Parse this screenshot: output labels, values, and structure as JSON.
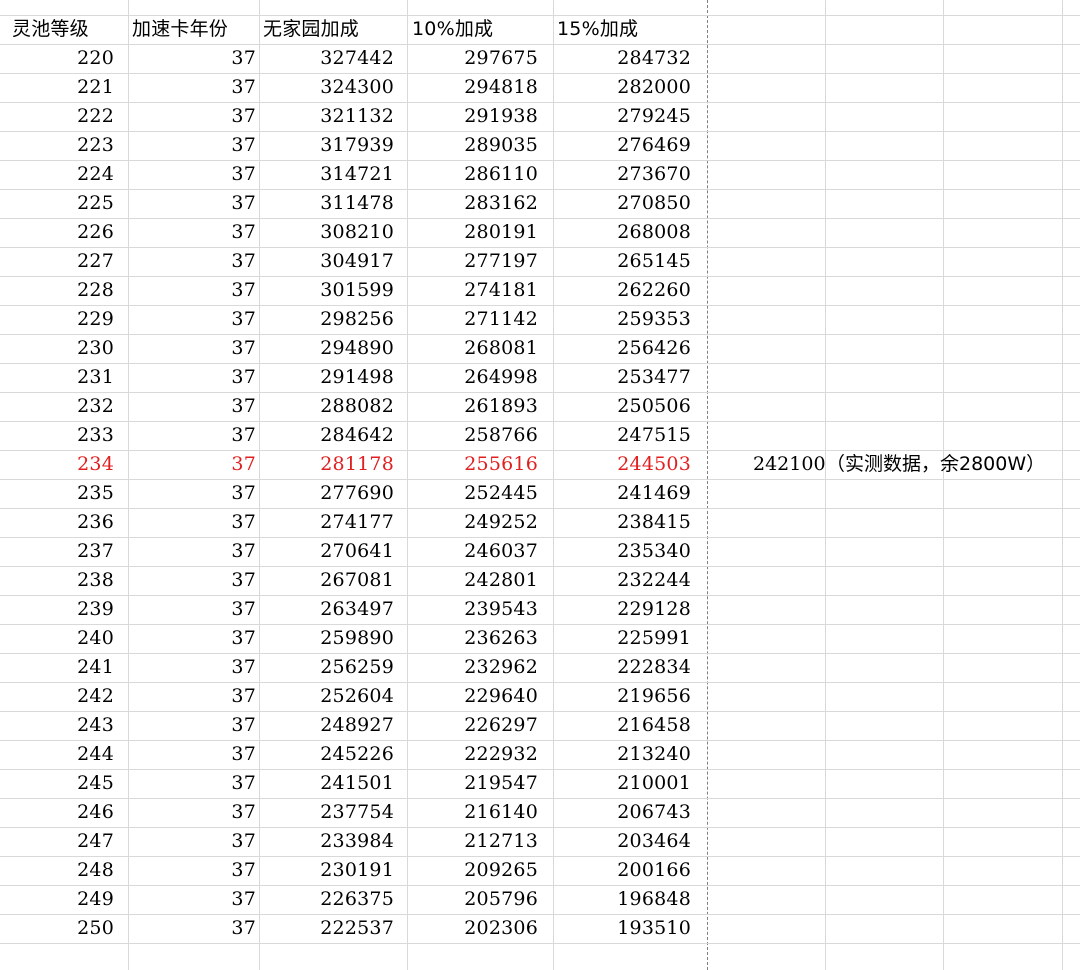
{
  "sheet": {
    "headers": [
      "灵池等级",
      "加速卡年份",
      "无家园加成",
      "10%加成",
      "15%加成"
    ],
    "highlight_color": "#e02020",
    "highlight_level": "234",
    "rows": [
      [
        "220",
        "37",
        "327442",
        "297675",
        "284732"
      ],
      [
        "221",
        "37",
        "324300",
        "294818",
        "282000"
      ],
      [
        "222",
        "37",
        "321132",
        "291938",
        "279245"
      ],
      [
        "223",
        "37",
        "317939",
        "289035",
        "276469"
      ],
      [
        "224",
        "37",
        "314721",
        "286110",
        "273670"
      ],
      [
        "225",
        "37",
        "311478",
        "283162",
        "270850"
      ],
      [
        "226",
        "37",
        "308210",
        "280191",
        "268008"
      ],
      [
        "227",
        "37",
        "304917",
        "277197",
        "265145"
      ],
      [
        "228",
        "37",
        "301599",
        "274181",
        "262260"
      ],
      [
        "229",
        "37",
        "298256",
        "271142",
        "259353"
      ],
      [
        "230",
        "37",
        "294890",
        "268081",
        "256426"
      ],
      [
        "231",
        "37",
        "291498",
        "264998",
        "253477"
      ],
      [
        "232",
        "37",
        "288082",
        "261893",
        "250506"
      ],
      [
        "233",
        "37",
        "284642",
        "258766",
        "247515"
      ],
      [
        "234",
        "37",
        "281178",
        "255616",
        "244503"
      ],
      [
        "235",
        "37",
        "277690",
        "252445",
        "241469"
      ],
      [
        "236",
        "37",
        "274177",
        "249252",
        "238415"
      ],
      [
        "237",
        "37",
        "270641",
        "246037",
        "235340"
      ],
      [
        "238",
        "37",
        "267081",
        "242801",
        "232244"
      ],
      [
        "239",
        "37",
        "263497",
        "239543",
        "229128"
      ],
      [
        "240",
        "37",
        "259890",
        "236263",
        "225991"
      ],
      [
        "241",
        "37",
        "256259",
        "232962",
        "222834"
      ],
      [
        "242",
        "37",
        "252604",
        "229640",
        "219656"
      ],
      [
        "243",
        "37",
        "248927",
        "226297",
        "216458"
      ],
      [
        "244",
        "37",
        "245226",
        "222932",
        "213240"
      ],
      [
        "245",
        "37",
        "241501",
        "219547",
        "210001"
      ],
      [
        "246",
        "37",
        "237754",
        "216140",
        "206743"
      ],
      [
        "247",
        "37",
        "233984",
        "212713",
        "203464"
      ],
      [
        "248",
        "37",
        "230191",
        "209265",
        "200166"
      ],
      [
        "249",
        "37",
        "226375",
        "205796",
        "196848"
      ],
      [
        "250",
        "37",
        "222537",
        "202306",
        "193510"
      ]
    ],
    "note": {
      "row_level": "234",
      "value": "242100",
      "text": "（实测数据，余2800W）"
    }
  }
}
